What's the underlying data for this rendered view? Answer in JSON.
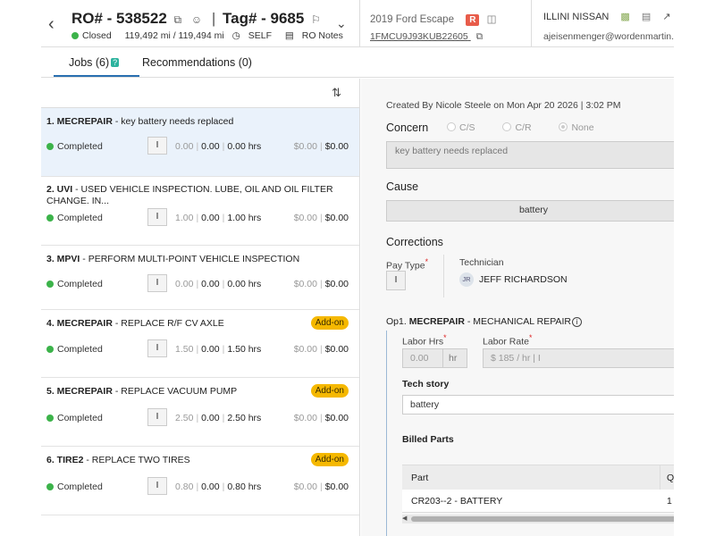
{
  "header": {
    "ro_label": "RO# - 538522",
    "tag_label": "Tag# - 9685",
    "status": "Closed",
    "mileage": "119,492 mi / 119,494 mi",
    "self_label": "SELF",
    "ro_notes": "RO Notes",
    "vehicle": "2019 Ford Escape",
    "vehicle_badge": "R",
    "vin": "1FMCU9J93KUB22605",
    "dealer": "ILLINI NISSAN",
    "email": "ajeisenmenger@wordenmartin.c"
  },
  "tabs": {
    "jobs": "Jobs (6)",
    "jobs_badge": "?",
    "recommendations": "Recommendations (0)"
  },
  "jobs": [
    {
      "code": "1. MECREPAIR",
      "desc": " - key battery needs replaced",
      "status": "Completed",
      "pay": "I",
      "n1": "0.00",
      "n2": "0.00",
      "n3": "0.00 hrs",
      "m1": "$0.00",
      "m2": "$0.00",
      "addon": ""
    },
    {
      "code": "2. UVI",
      "desc": " - USED VEHICLE INSPECTION. LUBE, OIL AND OIL FILTER CHANGE. IN...",
      "status": "Completed",
      "pay": "I",
      "n1": "1.00",
      "n2": "0.00",
      "n3": "1.00 hrs",
      "m1": "$0.00",
      "m2": "$0.00",
      "addon": ""
    },
    {
      "code": "3. MPVI",
      "desc": " - PERFORM MULTI-POINT VEHICLE INSPECTION",
      "status": "Completed",
      "pay": "I",
      "n1": "0.00",
      "n2": "0.00",
      "n3": "0.00 hrs",
      "m1": "$0.00",
      "m2": "$0.00",
      "addon": ""
    },
    {
      "code": "4. MECREPAIR",
      "desc": " - REPLACE R/F CV AXLE",
      "status": "Completed",
      "pay": "I",
      "n1": "1.50",
      "n2": "0.00",
      "n3": "1.50 hrs",
      "m1": "$0.00",
      "m2": "$0.00",
      "addon": "Add-on"
    },
    {
      "code": "5. MECREPAIR",
      "desc": " - REPLACE VACUUM PUMP",
      "status": "Completed",
      "pay": "I",
      "n1": "2.50",
      "n2": "0.00",
      "n3": "2.50 hrs",
      "m1": "$0.00",
      "m2": "$0.00",
      "addon": "Add-on"
    },
    {
      "code": "6. TIRE2",
      "desc": " - REPLACE TWO TIRES",
      "status": "Completed",
      "pay": "I",
      "n1": "0.80",
      "n2": "0.00",
      "n3": "0.80 hrs",
      "m1": "$0.00",
      "m2": "$0.00",
      "addon": "Add-on"
    }
  ],
  "detail": {
    "created": "Created By Nicole Steele on Mon Apr 20 2026 | 3:02 PM",
    "concern_title": "Concern",
    "concern_opts": [
      "C/S",
      "C/R",
      "None"
    ],
    "concern_text": "key battery needs replaced",
    "cause_title": "Cause",
    "cause_text": "battery",
    "corrections_title": "Corrections",
    "pay_type_label": "Pay Type",
    "pay_type_value": "I",
    "technician_label": "Technician",
    "tech_initials": "JR",
    "tech_name": "JEFF RICHARDSON",
    "op_prefix": "Op1. ",
    "op_code": "MECREPAIR",
    "op_desc": " - MECHANICAL REPAIR",
    "labor_hrs_label": "Labor Hrs",
    "labor_hrs_placeholder": "0.00",
    "labor_hrs_unit": "hr",
    "labor_rate_label": "Labor Rate",
    "labor_rate_placeholder": "$ 185 / hr | I",
    "tech_story_label": "Tech story",
    "tech_story_value": "battery",
    "billed_parts_label": "Billed Parts",
    "table_col_part": "Part",
    "table_col_q": "Q",
    "part_name": "CR203--2 - BATTERY",
    "part_qty": "1"
  }
}
